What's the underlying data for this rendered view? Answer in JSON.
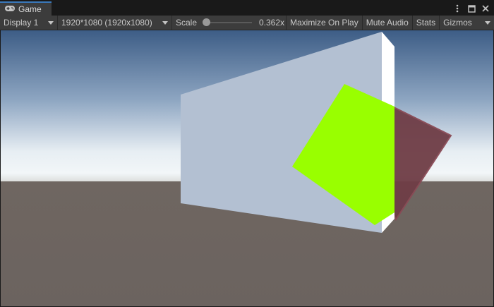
{
  "tab": {
    "title": "Game",
    "icon": "gamepad-icon"
  },
  "window_menu": [
    {
      "icon": "kebab-menu-icon"
    },
    {
      "icon": "maximize-icon"
    },
    {
      "icon": "close-icon"
    }
  ],
  "toolbar": {
    "display": "Display 1",
    "resolution": "1920*1080 (1920x1080)",
    "scale_label": "Scale",
    "scale_value": "0.362x",
    "scale_fraction": 0.0,
    "maximize_on_play": "Maximize On Play",
    "mute_audio": "Mute Audio",
    "stats": "Stats",
    "gizmos": "Gizmos"
  },
  "scene": {
    "colors": {
      "sky_top": "#3d5d86",
      "sky_horizon": "#f2f6f8",
      "ground": "#6b635f",
      "cube_front": "#b3c0d2",
      "cube_side": "#ffffff",
      "green_quad": "#99ff00",
      "red_quad": "#6f3d46"
    }
  }
}
